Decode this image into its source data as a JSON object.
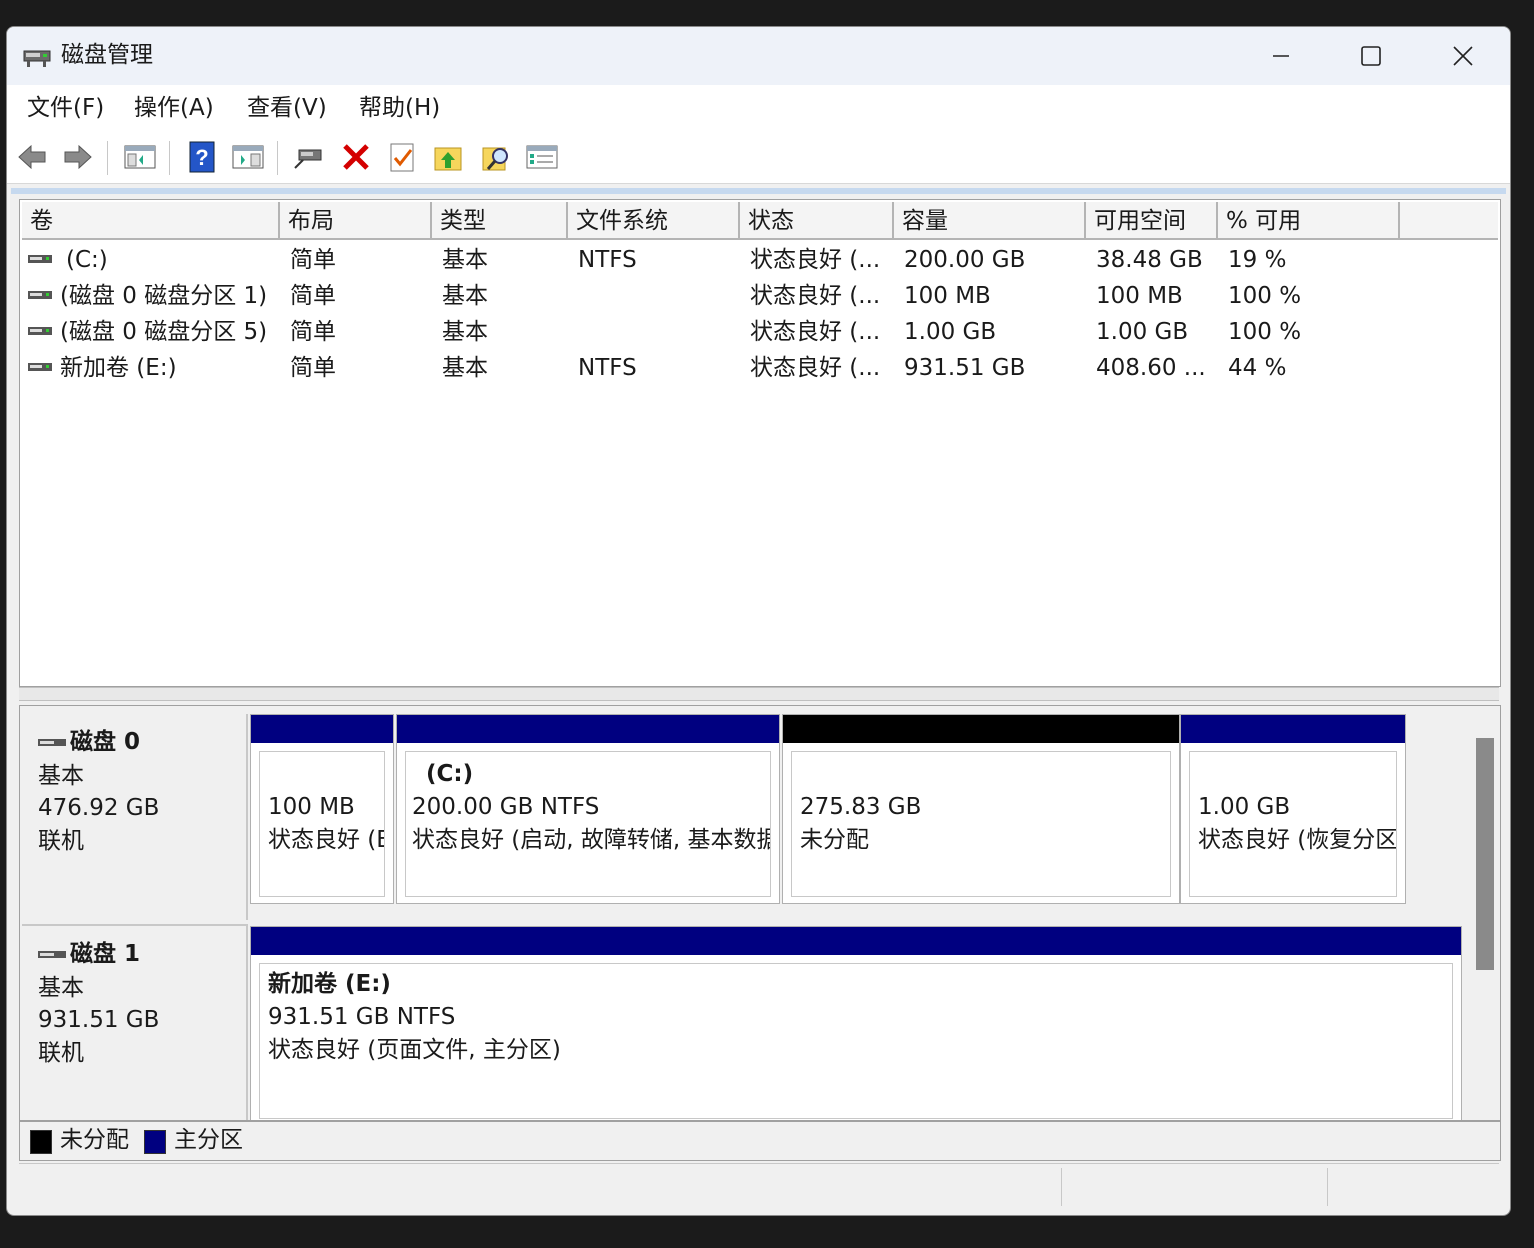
{
  "window": {
    "title": "磁盘管理"
  },
  "menu": [
    "文件(F)",
    "操作(A)",
    "查看(V)",
    "帮助(H)"
  ],
  "toolbar": {
    "icons": [
      "back-icon",
      "forward-icon",
      "console-tree-icon",
      "help-icon",
      "show-pane-icon",
      "connect-disk-icon",
      "delete-icon",
      "properties-icon",
      "up-icon",
      "find-icon",
      "view-list-icon"
    ]
  },
  "columns": [
    "卷",
    "布局",
    "类型",
    "文件系统",
    "状态",
    "容量",
    "可用空间",
    "% 可用"
  ],
  "volumes": [
    [
      "(C:)",
      "简单",
      "基本",
      "NTFS",
      "状态良好 (...",
      "200.00 GB",
      "38.48 GB",
      "19 %"
    ],
    [
      "(磁盘 0 磁盘分区 1)",
      "简单",
      "基本",
      "",
      "状态良好 (...",
      "100 MB",
      "100 MB",
      "100 %"
    ],
    [
      "(磁盘 0 磁盘分区 5)",
      "简单",
      "基本",
      "",
      "状态良好 (...",
      "1.00 GB",
      "1.00 GB",
      "100 %"
    ],
    [
      "新加卷 (E:)",
      "简单",
      "基本",
      "NTFS",
      "状态良好 (...",
      "931.51 GB",
      "408.60 ...",
      "44 %"
    ]
  ],
  "disks": [
    {
      "name": "磁盘 0",
      "type": "基本",
      "size": "476.92 GB",
      "state": "联机",
      "partitions": [
        {
          "title": "",
          "line1": "100 MB",
          "line2": "状态良好 (E",
          "kind": "primary"
        },
        {
          "title": "(C:)",
          "line1": "200.00 GB NTFS",
          "line2": "状态良好 (启动, 故障转储, 基本数据",
          "kind": "primary"
        },
        {
          "title": "",
          "line1": "275.83 GB",
          "line2": "未分配",
          "kind": "unallocated"
        },
        {
          "title": "",
          "line1": "1.00 GB",
          "line2": "状态良好 (恢复分区",
          "kind": "primary"
        }
      ]
    },
    {
      "name": "磁盘 1",
      "type": "基本",
      "size": "931.51 GB",
      "state": "联机",
      "partitions": [
        {
          "title": "新加卷  (E:)",
          "line1": "931.51 GB NTFS",
          "line2": "状态良好 (页面文件, 主分区)",
          "kind": "primary"
        }
      ]
    }
  ],
  "legend": [
    {
      "label": "未分配",
      "color": "#000000"
    },
    {
      "label": "主分区",
      "color": "#000080"
    }
  ],
  "colors": {
    "primary": "#000080",
    "unallocated": "#000000"
  }
}
